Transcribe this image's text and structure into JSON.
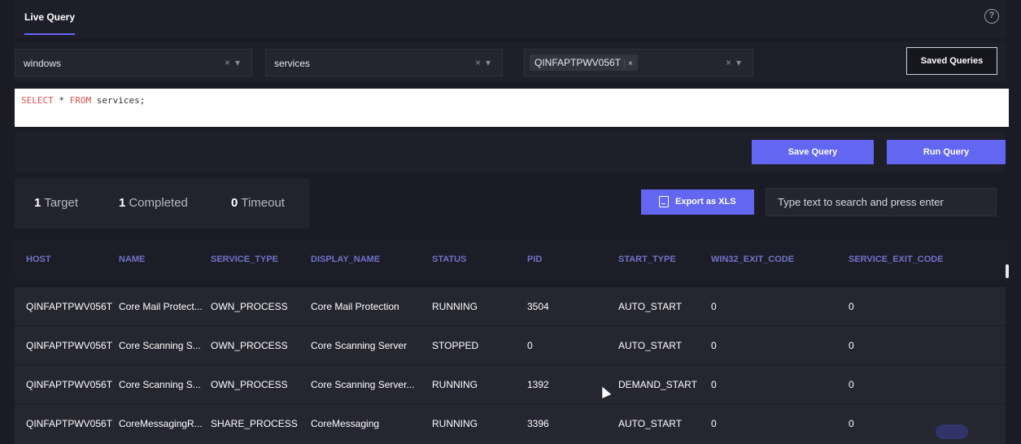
{
  "header": {
    "tab_label": "Live Query",
    "help_icon": "?"
  },
  "filters": {
    "os_value": "windows",
    "table_value": "services",
    "host_chip": "QINFAPTPWV056T",
    "chip_remove": "×",
    "clear_symbol": "×",
    "dropdown_symbol": "▾",
    "saved_queries_label": "Saved Queries"
  },
  "editor": {
    "kw1": "SELECT",
    "star": "*",
    "kw2": "FROM",
    "rest": "services;"
  },
  "actions": {
    "save_label": "Save Query",
    "run_label": "Run Query"
  },
  "stats": {
    "target_count": "1",
    "target_label": "Target",
    "completed_count": "1",
    "completed_label": "Completed",
    "timeout_count": "0",
    "timeout_label": "Timeout"
  },
  "export": {
    "label": "Export as XLS"
  },
  "search": {
    "text": "Type text to search and press enter"
  },
  "table": {
    "headers": [
      "HOST",
      "NAME",
      "SERVICE_TYPE",
      "DISPLAY_NAME",
      "STATUS",
      "PID",
      "START_TYPE",
      "WIN32_EXIT_CODE",
      "SERVICE_EXIT_CODE"
    ],
    "rows": [
      [
        "QINFAPTPWV056T",
        "Core Mail Protect...",
        "OWN_PROCESS",
        "Core Mail Protection",
        "RUNNING",
        "3504",
        "AUTO_START",
        "0",
        "0"
      ],
      [
        "QINFAPTPWV056T",
        "Core Scanning S...",
        "OWN_PROCESS",
        "Core Scanning Server",
        "STOPPED",
        "0",
        "AUTO_START",
        "0",
        "0"
      ],
      [
        "QINFAPTPWV056T",
        "Core Scanning S...",
        "OWN_PROCESS",
        "Core Scanning Server...",
        "RUNNING",
        "1392",
        "DEMAND_START",
        "0",
        "0"
      ],
      [
        "QINFAPTPWV056T",
        "CoreMessagingR...",
        "SHARE_PROCESS",
        "CoreMessaging",
        "RUNNING",
        "3396",
        "AUTO_START",
        "0",
        "0"
      ]
    ]
  },
  "colors": {
    "accent": "#6366f1",
    "background": "#1b1b25",
    "header_text": "#6f73c8"
  }
}
